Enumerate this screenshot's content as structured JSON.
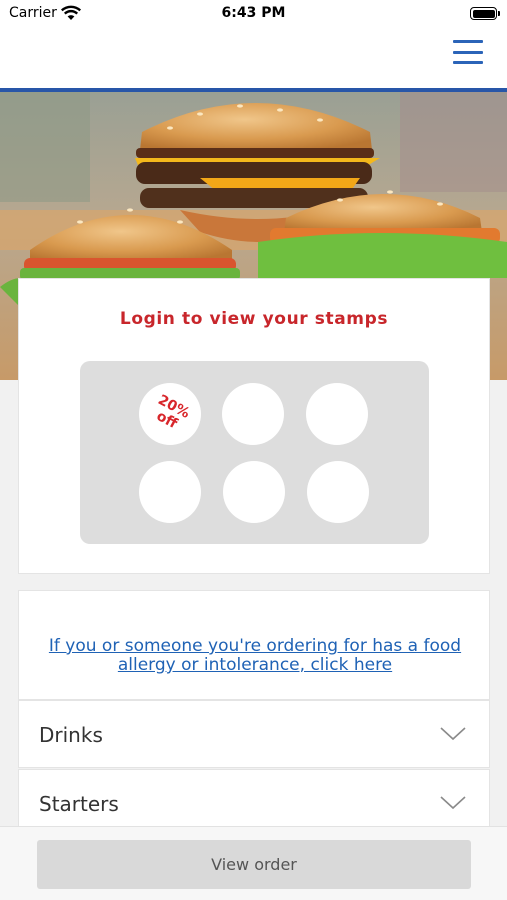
{
  "status_bar": {
    "carrier": "Carrier",
    "time": "6:43 PM"
  },
  "colors": {
    "accent_blue": "#2856a8",
    "link_blue": "#1f62b5",
    "title_red": "#c8262b"
  },
  "stamp_card": {
    "title": "Login to view your stamps",
    "stamps": [
      {
        "line1": "20%",
        "line2": "off"
      },
      {
        "line1": "",
        "line2": ""
      },
      {
        "line1": "",
        "line2": ""
      },
      {
        "line1": "",
        "line2": ""
      },
      {
        "line1": "",
        "line2": ""
      },
      {
        "line1": "",
        "line2": ""
      }
    ]
  },
  "allergy": {
    "link_text": "If you or someone you're ordering for has a food allergy or intolerance, click here"
  },
  "menu": {
    "categories": [
      {
        "label": "Drinks",
        "icon": "chevron-down-icon"
      },
      {
        "label": "Starters",
        "icon": "chevron-down-icon"
      }
    ]
  },
  "footer": {
    "view_order_label": "View order"
  },
  "icons": {
    "menu": "hamburger-menu-icon",
    "wifi": "wifi-icon",
    "battery": "battery-icon"
  }
}
